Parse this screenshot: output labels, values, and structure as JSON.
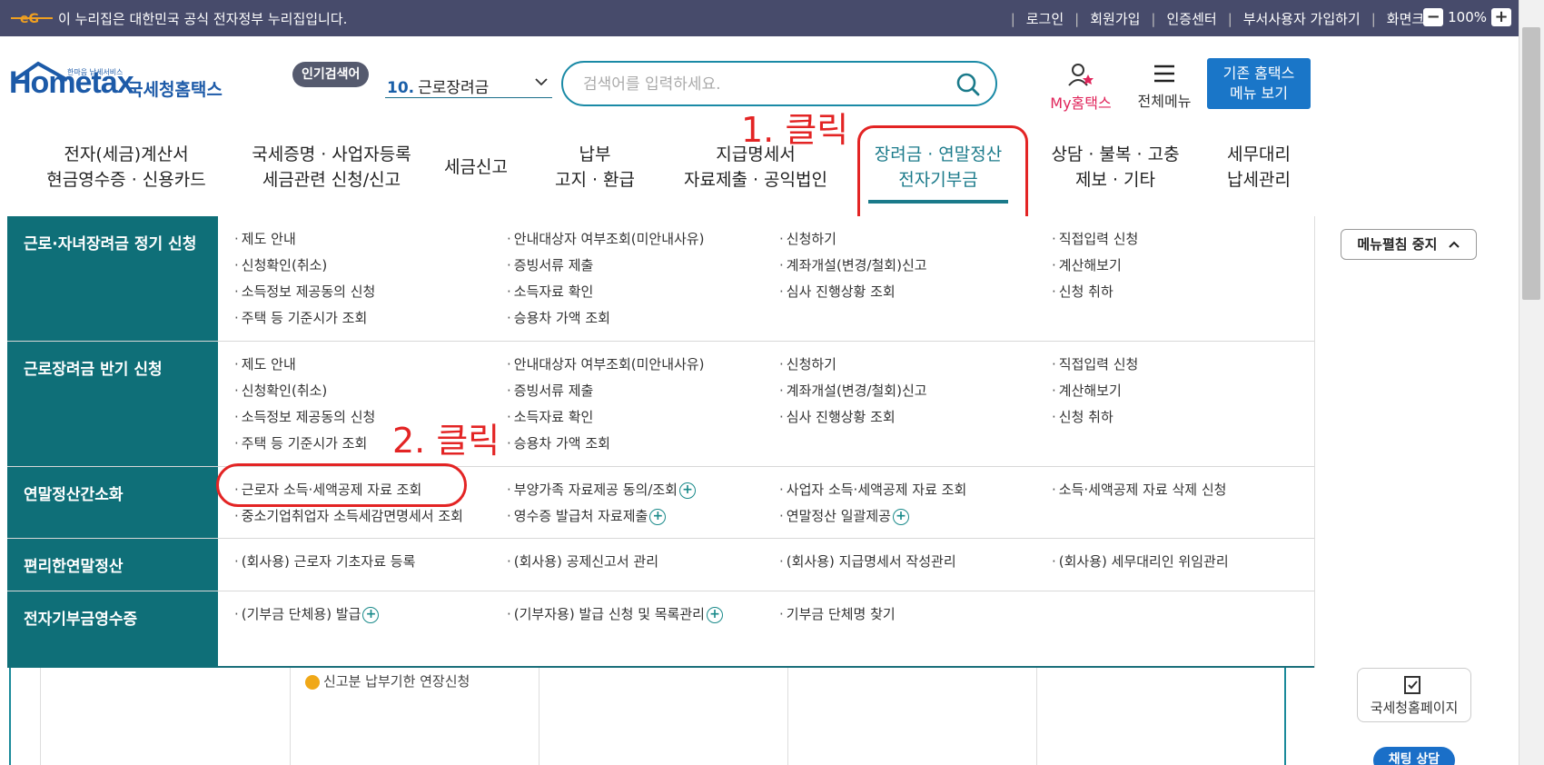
{
  "gov_bar": {
    "notice": "이 누리집은 대한민국 공식 전자정부 누리집입니다.",
    "links": [
      "로그인",
      "회원가입",
      "인증센터",
      "부서사용자 가입하기",
      "화면크기"
    ],
    "zoom": "100%"
  },
  "header": {
    "logo_main": "Hometax",
    "logo_tagline": "한마음 납세서비스",
    "logo_name": "국세청홈택스",
    "popular_badge": "인기검색어",
    "popular_num": "10.",
    "popular_term": "근로장려금",
    "search_placeholder": "검색어를 입력하세요.",
    "my_home": "My홈택스",
    "all_menu": "전체메뉴",
    "classic_line1": "기존 홈택스",
    "classic_line2": "메뉴 보기"
  },
  "gnb": [
    {
      "l1": "전자(세금)계산서",
      "l2": "현금영수증 · 신용카드"
    },
    {
      "l1": "국세증명 · 사업자등록",
      "l2": "세금관련 신청/신고"
    },
    {
      "l1": "세금신고",
      "l2": ""
    },
    {
      "l1": "납부",
      "l2": "고지 · 환급"
    },
    {
      "l1": "지급명세서",
      "l2": "자료제출 · 공익법인"
    },
    {
      "l1": "장려금 · 연말정산",
      "l2": "전자기부금"
    },
    {
      "l1": "상담 · 불복 · 고충",
      "l2": "제보 · 기타"
    },
    {
      "l1": "세무대리",
      "l2": "납세관리"
    }
  ],
  "annotations": {
    "step1": "1. 클릭",
    "step2": "2. 클릭"
  },
  "mega": {
    "stop_label": "메뉴펼침 중지",
    "categories": [
      {
        "title": "근로·자녀장려금 정기 신청",
        "links": [
          "제도 안내",
          "안내대상자 여부조회(미안내사유)",
          "신청하기",
          "직접입력 신청",
          "신청확인(취소)",
          "증빙서류 제출",
          "계좌개설(변경/철회)신고",
          "계산해보기",
          "소득정보 제공동의 신청",
          "소득자료 확인",
          "심사 진행상황 조회",
          "신청 취하",
          "주택 등 기준시가 조회",
          "승용차 가액 조회"
        ]
      },
      {
        "title": "근로장려금 반기 신청",
        "links": [
          "제도 안내",
          "안내대상자 여부조회(미안내사유)",
          "신청하기",
          "직접입력 신청",
          "신청확인(취소)",
          "증빙서류 제출",
          "계좌개설(변경/철회)신고",
          "계산해보기",
          "소득정보 제공동의 신청",
          "소득자료 확인",
          "심사 진행상황 조회",
          "신청 취하",
          "주택 등 기준시가 조회",
          "승용차 가액 조회"
        ]
      },
      {
        "title": "연말정산간소화",
        "links": [
          "근로자 소득·세액공제 자료 조회",
          "부양가족 자료제공 동의/조회",
          "사업자 소득·세액공제 자료 조회",
          "소득·세액공제 자료 삭제 신청",
          "중소기업취업자 소득세감면명세서 조회",
          "영수증 발급처 자료제출",
          "연말정산 일괄제공"
        ]
      },
      {
        "title": "편리한연말정산",
        "links": [
          "(회사용) 근로자 기초자료 등록",
          "(회사용) 공제신고서 관리",
          "(회사용) 지급명세서 작성관리",
          "(회사용) 세무대리인 위임관리"
        ]
      },
      {
        "title": "전자기부금영수증",
        "links": [
          "(기부금 단체용) 발급",
          "(기부자용) 발급 신청 및 목록관리",
          "기부금 단체명 찾기"
        ]
      }
    ]
  },
  "below": {
    "partial_text": "신고분 납부기한 연장신청",
    "nts_card": "국세청홈페이지",
    "chat": "채팅 상담"
  }
}
